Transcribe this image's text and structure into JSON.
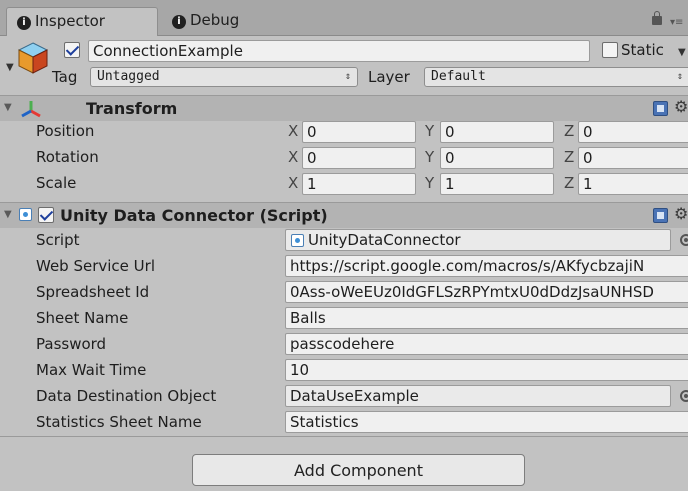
{
  "tabs": [
    {
      "label": "Inspector",
      "icon": "info-icon"
    },
    {
      "label": "Debug",
      "icon": "info-icon"
    }
  ],
  "header": {
    "object_name": "ConnectionExample",
    "active_checked": true,
    "static_label": "Static",
    "tag_label": "Tag",
    "tag_value": "Untagged",
    "layer_label": "Layer",
    "layer_value": "Default"
  },
  "transform": {
    "title": "Transform",
    "axes": {
      "x": "X",
      "y": "Y",
      "z": "Z"
    },
    "rows": [
      {
        "label": "Position",
        "x": "0",
        "y": "0",
        "z": "0"
      },
      {
        "label": "Rotation",
        "x": "0",
        "y": "0",
        "z": "0"
      },
      {
        "label": "Scale",
        "x": "1",
        "y": "1",
        "z": "1"
      }
    ]
  },
  "script_component": {
    "title": "Unity Data Connector (Script)",
    "enabled": true,
    "fields": [
      {
        "label": "Script",
        "value": "UnityDataConnector"
      },
      {
        "label": "Web Service Url",
        "value": "https://script.google.com/macros/s/AKfycbzajiN"
      },
      {
        "label": "Spreadsheet Id",
        "value": "0Ass-oWeEUz0IdGFLSzRPYmtxU0dDdzJsaUNHSD"
      },
      {
        "label": "Sheet Name",
        "value": "Balls"
      },
      {
        "label": "Password",
        "value": "passcodehere"
      },
      {
        "label": "Max Wait Time",
        "value": "10"
      },
      {
        "label": "Data Destination Object",
        "value": "DataUseExample"
      },
      {
        "label": "Statistics Sheet Name",
        "value": "Statistics"
      }
    ]
  },
  "add_component_label": "Add Component",
  "colors": {
    "background": "#c2c2c2",
    "tab_bar": "#a7a7a7",
    "header_band": "#b3b3b3",
    "checkmark": "#1e3f9c"
  }
}
